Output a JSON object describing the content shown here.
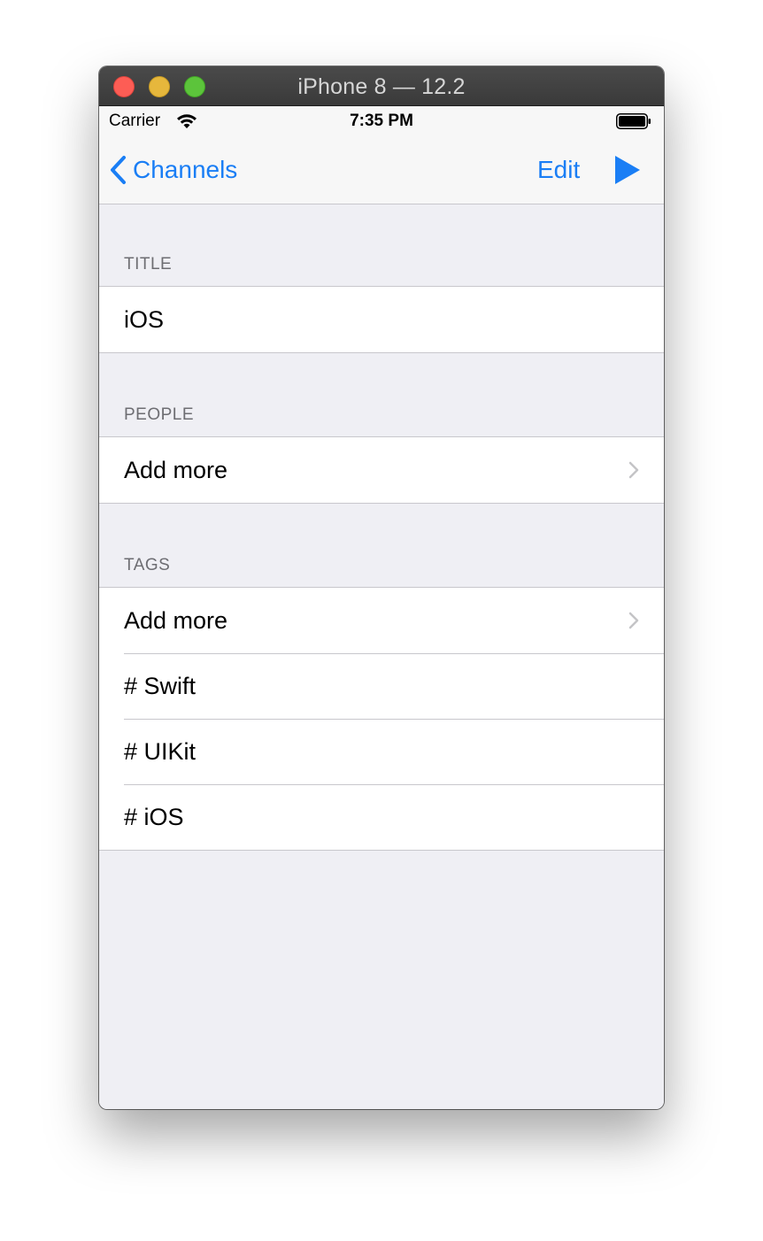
{
  "window": {
    "title": "iPhone 8 — 12.2"
  },
  "status_bar": {
    "carrier": "Carrier",
    "time": "7:35 PM"
  },
  "nav": {
    "back_label": "Channels",
    "edit_label": "Edit"
  },
  "sections": {
    "title": {
      "header": "TITLE",
      "value": "iOS"
    },
    "people": {
      "header": "PEOPLE",
      "add_label": "Add more"
    },
    "tags": {
      "header": "TAGS",
      "add_label": "Add more",
      "items": [
        "# Swift",
        "# UIKit",
        "# iOS"
      ]
    }
  },
  "colors": {
    "tint": "#1a7ef5",
    "grouped_background": "#efeff4",
    "separator": "#c8c7cc",
    "section_header_text": "#6d6d72"
  },
  "icons": {
    "back": "chevron-left-icon",
    "play": "play-icon",
    "disclosure": "chevron-right-icon",
    "wifi": "wifi-icon",
    "battery": "battery-icon"
  }
}
